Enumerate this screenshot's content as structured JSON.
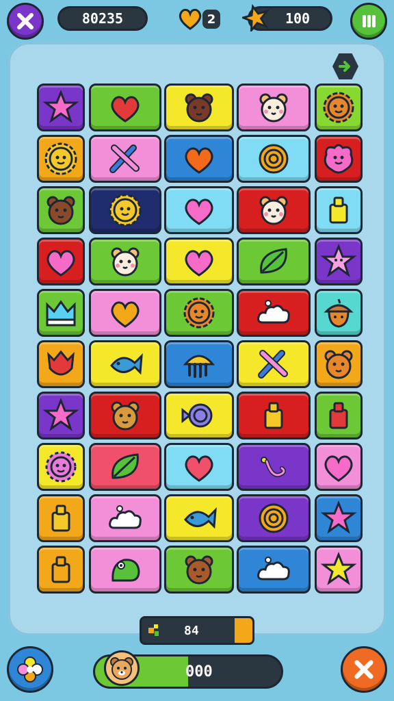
{
  "hud": {
    "score": "80235",
    "lives": "2",
    "stars": "100"
  },
  "bottom": {
    "target_count": "84",
    "progress_value": "000",
    "progress_fraction": 0.5
  },
  "colors": {
    "purple": "#7a36c8",
    "green": "#6cc834",
    "yellow": "#f5e82a",
    "pink": "#f38fd8",
    "orange": "#f3a81a",
    "blue": "#2f86d6",
    "navy": "#1f2c6e",
    "cyan": "#7fdcf4",
    "red": "#d81f1f",
    "coral": "#f0506a",
    "teal": "#56d7d0",
    "lime": "#88d832"
  },
  "board": {
    "rows": [
      [
        {
          "bg": "purple",
          "icon": "star-icon"
        },
        {
          "bg": "green",
          "icon": "heart-icon"
        },
        {
          "bg": "yellow",
          "icon": "bear-icon"
        },
        {
          "bg": "pink",
          "icon": "hamster-icon"
        },
        {
          "bg": "lime",
          "icon": "gear-face-icon"
        }
      ],
      [
        {
          "bg": "orange",
          "icon": "sun-face-icon"
        },
        {
          "bg": "pink",
          "icon": "crossed-swords-icon"
        },
        {
          "bg": "blue",
          "icon": "heart-icon"
        },
        {
          "bg": "cyan",
          "icon": "spiral-shell-icon"
        },
        {
          "bg": "red",
          "icon": "blob-face-icon"
        }
      ],
      [
        {
          "bg": "green",
          "icon": "bear-icon"
        },
        {
          "bg": "navy",
          "icon": "sun-face-icon"
        },
        {
          "bg": "cyan",
          "icon": "heart-icon"
        },
        {
          "bg": "red",
          "icon": "hamster-icon"
        },
        {
          "bg": "cyan",
          "icon": "block-icon"
        }
      ],
      [
        {
          "bg": "red",
          "icon": "heart-icon"
        },
        {
          "bg": "green",
          "icon": "hamster-icon"
        },
        {
          "bg": "yellow",
          "icon": "heart-icon"
        },
        {
          "bg": "green",
          "icon": "leaf-icon"
        },
        {
          "bg": "purple",
          "icon": "star-face-icon"
        }
      ],
      [
        {
          "bg": "green",
          "icon": "crown-icon"
        },
        {
          "bg": "pink",
          "icon": "heart-icon"
        },
        {
          "bg": "green",
          "icon": "gear-face-icon"
        },
        {
          "bg": "red",
          "icon": "cloud-icon"
        },
        {
          "bg": "teal",
          "icon": "acorn-icon"
        }
      ],
      [
        {
          "bg": "orange",
          "icon": "tulip-icon"
        },
        {
          "bg": "yellow",
          "icon": "fish-icon"
        },
        {
          "bg": "blue",
          "icon": "jellyfish-icon"
        },
        {
          "bg": "yellow",
          "icon": "crossed-swords-icon"
        },
        {
          "bg": "orange",
          "icon": "bear-icon"
        }
      ],
      [
        {
          "bg": "purple",
          "icon": "star-icon"
        },
        {
          "bg": "red",
          "icon": "bear-icon"
        },
        {
          "bg": "yellow",
          "icon": "candy-icon"
        },
        {
          "bg": "red",
          "icon": "block-icon"
        },
        {
          "bg": "green",
          "icon": "block-icon"
        }
      ],
      [
        {
          "bg": "yellow",
          "icon": "spiky-face-icon"
        },
        {
          "bg": "coral",
          "icon": "leaf-icon"
        },
        {
          "bg": "cyan",
          "icon": "heart-icon"
        },
        {
          "bg": "purple",
          "icon": "hook-icon"
        },
        {
          "bg": "pink",
          "icon": "heart-icon"
        }
      ],
      [
        {
          "bg": "orange",
          "icon": "block-icon"
        },
        {
          "bg": "pink",
          "icon": "cloud-icon"
        },
        {
          "bg": "yellow",
          "icon": "fish-icon"
        },
        {
          "bg": "purple",
          "icon": "spiral-shell-icon"
        },
        {
          "bg": "blue",
          "icon": "star-icon"
        }
      ],
      [
        {
          "bg": "orange",
          "icon": "block-icon"
        },
        {
          "bg": "pink",
          "icon": "frog-icon"
        },
        {
          "bg": "green",
          "icon": "bear-icon"
        },
        {
          "bg": "blue",
          "icon": "cloud-icon"
        },
        {
          "bg": "pink",
          "icon": "star-icon"
        }
      ]
    ]
  }
}
